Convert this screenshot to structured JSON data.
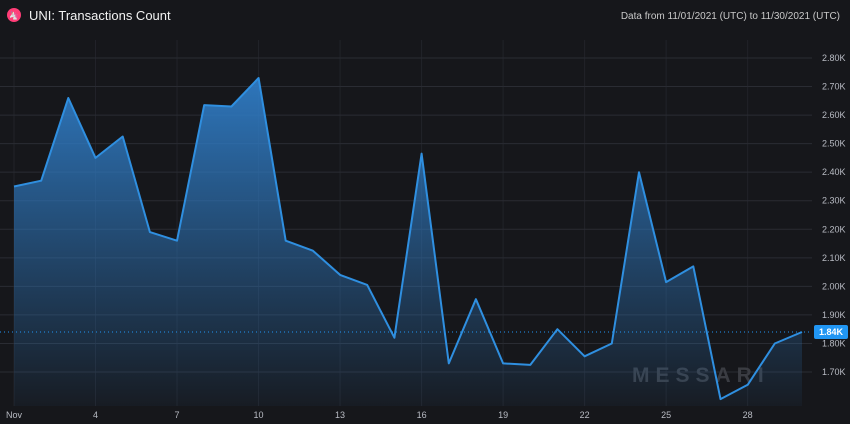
{
  "header": {
    "logo_glyph": "🦄",
    "title": "UNI: Transactions Count",
    "range": "Data from 11/01/2021 (UTC) to 11/30/2021 (UTC)"
  },
  "watermark": "MESSARI",
  "colors": {
    "background": "#16171b",
    "line": "#2f8fe0",
    "fill_top": "#2f7bc4",
    "grid": "#2a2c33",
    "badge": "#2196f3",
    "logo": "#ff3d77"
  },
  "chart_data": {
    "type": "area",
    "title": "UNI: Transactions Count",
    "x": [
      1,
      2,
      3,
      4,
      5,
      6,
      7,
      8,
      9,
      10,
      11,
      12,
      13,
      14,
      15,
      16,
      17,
      18,
      19,
      20,
      21,
      22,
      23,
      24,
      25,
      26,
      27,
      28,
      29,
      30
    ],
    "values": [
      2350,
      2370,
      2660,
      2450,
      2525,
      2190,
      2160,
      2635,
      2630,
      2730,
      2160,
      2125,
      2040,
      2005,
      1820,
      2465,
      1730,
      1955,
      1730,
      1725,
      1850,
      1755,
      1800,
      2400,
      2015,
      2070,
      1605,
      1655,
      1800,
      1840
    ],
    "ylim": [
      1610,
      2850
    ],
    "yticks": [
      "1.70K",
      "1.80K",
      "1.90K",
      "2.00K",
      "2.10K",
      "2.20K",
      "2.30K",
      "2.40K",
      "2.50K",
      "2.60K",
      "2.70K",
      "2.80K"
    ],
    "ytick_values": [
      1700,
      1800,
      1900,
      2000,
      2100,
      2200,
      2300,
      2400,
      2500,
      2600,
      2700,
      2800
    ],
    "xticks": [
      "Nov",
      "4",
      "7",
      "10",
      "13",
      "16",
      "19",
      "22",
      "25",
      "28"
    ],
    "xtick_values": [
      1,
      4,
      7,
      10,
      13,
      16,
      19,
      22,
      25,
      28
    ],
    "last_value_label": "1.84K",
    "last_value": 1840,
    "xlabel": "",
    "ylabel": "",
    "grid": true,
    "unit_note": ""
  }
}
